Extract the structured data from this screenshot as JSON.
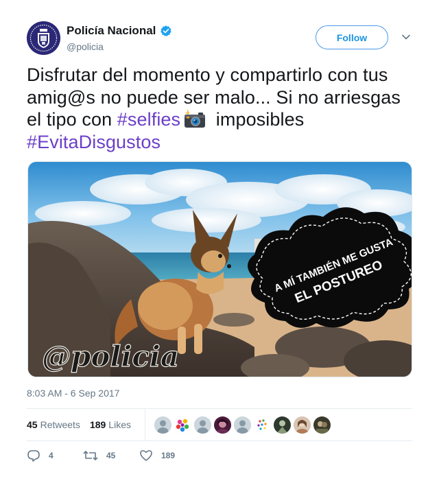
{
  "account": {
    "display_name": "Policía Nacional",
    "handle": "@policia",
    "verified": true
  },
  "follow_button": {
    "label": "Follow"
  },
  "tweet": {
    "text_part1": "Disfrutar del momento y compartirlo con tus amig@s no puede ser malo... Si no arriesgas el tipo con ",
    "hashtag_1": "#selfies",
    "emoji": "camera-with-flash-icon",
    "text_part2": " imposibles ",
    "hashtag_2": "#EvitaDisgustos"
  },
  "media": {
    "speech_bubble_line1": "A MÍ TAMBIÉN ME GUSTA",
    "speech_bubble_line2": "EL POSTUREO",
    "watermark": "@policia"
  },
  "timestamp": "8:03 AM - 6 Sep 2017",
  "stats": {
    "retweets_count": "45",
    "retweets_label": "Retweets",
    "likes_count": "189",
    "likes_label": "Likes"
  },
  "actions": {
    "reply_count": "4",
    "retweet_count": "45",
    "like_count": "189"
  },
  "colors": {
    "link": "#1b95e0",
    "hashtag": "#6b3fc9",
    "muted": "#657786",
    "text": "#14171a",
    "verified": "#1da1f2"
  }
}
